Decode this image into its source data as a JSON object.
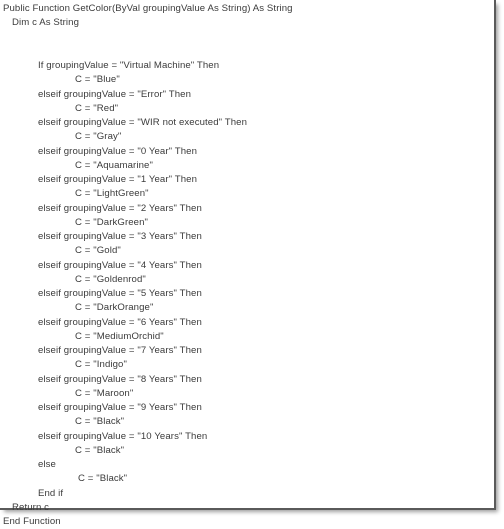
{
  "document": {
    "kind": "code-listing",
    "language": "Visual Basic .NET",
    "function_name": "GetColor",
    "text_color": "#3b3b3b",
    "background_color": "#ffffff",
    "border_color": "#5a5a5a"
  },
  "code": {
    "lines": [
      {
        "indent": 0,
        "text": "Public Function GetColor(ByVal groupingValue As String) As String"
      },
      {
        "indent": 1,
        "text": "Dim c As String"
      },
      {
        "indent": 0,
        "text": ""
      },
      {
        "indent": 0,
        "text": ""
      },
      {
        "indent": 2,
        "text": "If groupingValue = \"Virtual Machine\" Then"
      },
      {
        "indent": 3,
        "text": "C = \"Blue\""
      },
      {
        "indent": 2,
        "text": "elseif groupingValue = \"Error\" Then"
      },
      {
        "indent": 3,
        "text": "C = \"Red\""
      },
      {
        "indent": 2,
        "text": "elseif groupingValue = \"WIR not executed\" Then"
      },
      {
        "indent": 3,
        "text": "C = \"Gray\""
      },
      {
        "indent": 2,
        "text": "elseif groupingValue = \"0 Year\" Then"
      },
      {
        "indent": 3,
        "text": "C = \"Aquamarine\""
      },
      {
        "indent": 2,
        "text": "elseif groupingValue = \"1 Year\" Then"
      },
      {
        "indent": 3,
        "text": "C = \"LightGreen\""
      },
      {
        "indent": 2,
        "text": "elseif groupingValue = \"2 Years\" Then"
      },
      {
        "indent": 3,
        "text": "C = \"DarkGreen\""
      },
      {
        "indent": 2,
        "text": "elseif groupingValue = \"3 Years\" Then"
      },
      {
        "indent": 3,
        "text": "C = \"Gold\""
      },
      {
        "indent": 2,
        "text": "elseif groupingValue = \"4 Years\" Then"
      },
      {
        "indent": 3,
        "text": "C = \"Goldenrod\""
      },
      {
        "indent": 2,
        "text": "elseif groupingValue = \"5 Years\" Then"
      },
      {
        "indent": 3,
        "text": "C = \"DarkOrange\""
      },
      {
        "indent": 2,
        "text": "elseif groupingValue = \"6 Years\" Then"
      },
      {
        "indent": 3,
        "text": "C = \"MediumOrchid\""
      },
      {
        "indent": 2,
        "text": "elseif groupingValue = \"7 Years\" Then"
      },
      {
        "indent": 3,
        "text": "C = \"Indigo\""
      },
      {
        "indent": 2,
        "text": "elseif groupingValue = \"8 Years\" Then"
      },
      {
        "indent": 3,
        "text": "C = \"Maroon\""
      },
      {
        "indent": 2,
        "text": "elseif groupingValue = \"9 Years\" Then"
      },
      {
        "indent": 3,
        "text": "C = \"Black\""
      },
      {
        "indent": 2,
        "text": "elseif groupingValue = \"10 Years\" Then"
      },
      {
        "indent": 3,
        "text": "C = \"Black\""
      },
      {
        "indent": 2,
        "text": "else"
      },
      {
        "indent": 4,
        "text": "C = \"Black\""
      },
      {
        "indent": 2,
        "text": "End if"
      },
      {
        "indent": 1,
        "text": "Return c"
      },
      {
        "indent": 0,
        "text": "End Function"
      }
    ],
    "color_mapping": [
      {
        "grouping_value": "Virtual Machine",
        "color": "Blue"
      },
      {
        "grouping_value": "Error",
        "color": "Red"
      },
      {
        "grouping_value": "WIR not executed",
        "color": "Gray"
      },
      {
        "grouping_value": "0 Year",
        "color": "Aquamarine"
      },
      {
        "grouping_value": "1 Year",
        "color": "LightGreen"
      },
      {
        "grouping_value": "2 Years",
        "color": "DarkGreen"
      },
      {
        "grouping_value": "3 Years",
        "color": "Gold"
      },
      {
        "grouping_value": "4 Years",
        "color": "Goldenrod"
      },
      {
        "grouping_value": "5 Years",
        "color": "DarkOrange"
      },
      {
        "grouping_value": "6 Years",
        "color": "MediumOrchid"
      },
      {
        "grouping_value": "7 Years",
        "color": "Indigo"
      },
      {
        "grouping_value": "8 Years",
        "color": "Maroon"
      },
      {
        "grouping_value": "9 Years",
        "color": "Black"
      },
      {
        "grouping_value": "10 Years",
        "color": "Black"
      },
      {
        "grouping_value": "else",
        "color": "Black"
      }
    ]
  }
}
